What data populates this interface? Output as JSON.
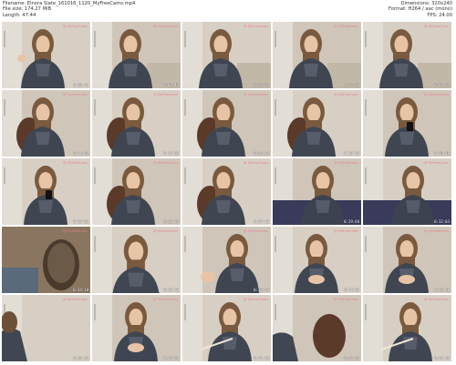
{
  "header": {
    "filename": "Filename: Elnora Slate_161016_1120_MyFreeCams.mp4",
    "file_size": "File size: 174.27 MiB",
    "length": "Length: 47:44",
    "dimensions": "Dimensions: 320x240",
    "format": "Format: H264 / aac (mono)",
    "fps": "FPS: 24.00"
  },
  "thumbnails": [
    {
      "time": "0:00:44",
      "scene": "sofa-gesture"
    },
    {
      "time": "0:02:48",
      "scene": "sofa"
    },
    {
      "time": "0:05:03",
      "scene": "sofa"
    },
    {
      "time": "0:07:18",
      "scene": "sofa"
    },
    {
      "time": "0:09:33",
      "scene": "sofa"
    },
    {
      "time": "0:11:48",
      "scene": "chair"
    },
    {
      "time": "0:14:03",
      "scene": "chair"
    },
    {
      "time": "0:16:18",
      "scene": "chair"
    },
    {
      "time": "0:18:33",
      "scene": "chair"
    },
    {
      "time": "0:20:48",
      "scene": "phone"
    },
    {
      "time": "0:23:03",
      "scene": "phone"
    },
    {
      "time": "0:25:18",
      "scene": "chair"
    },
    {
      "time": "0:27:33",
      "scene": "chair"
    },
    {
      "time": "0:29:48",
      "scene": "lean"
    },
    {
      "time": "0:32:03",
      "scene": "lean"
    },
    {
      "time": "0:34:18",
      "scene": "empty-chair"
    },
    {
      "time": "0:36:33",
      "scene": "close"
    },
    {
      "time": "0:38:48",
      "scene": "side"
    },
    {
      "time": "0:41:03",
      "scene": "hands"
    },
    {
      "time": "0:43:18",
      "scene": "hands"
    },
    {
      "time": "0:45:33",
      "scene": "partial"
    },
    {
      "time": "0:47:03",
      "scene": "hands"
    },
    {
      "time": "0:47:18",
      "scene": "stick"
    },
    {
      "time": "0:47:33",
      "scene": "partial-chair"
    },
    {
      "time": "0:47:44",
      "scene": "stick"
    }
  ],
  "watermark": "@ MyFreeCams"
}
